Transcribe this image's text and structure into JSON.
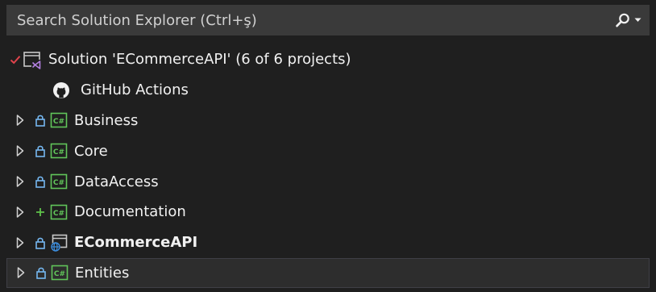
{
  "search": {
    "placeholder": "Search Solution Explorer (Ctrl+ş)",
    "icon": "search-icon"
  },
  "solution": {
    "label": "Solution 'ECommerceAPI' (6 of 6 projects)",
    "status_icon": "checkmark-icon",
    "icon": "solution-icon"
  },
  "github": {
    "label": "GitHub Actions",
    "icon": "github-icon"
  },
  "projects": [
    {
      "label": "Business",
      "state_icon": "lock-icon",
      "type_icon": "csharp-project-icon"
    },
    {
      "label": "Core",
      "state_icon": "lock-icon",
      "type_icon": "csharp-project-icon"
    },
    {
      "label": "DataAccess",
      "state_icon": "lock-icon",
      "type_icon": "csharp-project-icon"
    },
    {
      "label": "Documentation",
      "state_icon": "plus-icon",
      "type_icon": "csharp-project-icon"
    },
    {
      "label": "ECommerceAPI",
      "state_icon": "lock-icon",
      "type_icon": "web-project-icon",
      "bold": true
    },
    {
      "label": "Entities",
      "state_icon": "lock-icon",
      "type_icon": "csharp-project-icon",
      "selected": true
    }
  ],
  "colors": {
    "background": "#1f1f1f",
    "search_background": "#3a3a3a",
    "text": "#f1f1f1",
    "lock": "#75b7f0",
    "added": "#5fc34a",
    "checkmark": "#e0434c",
    "csharp_green": "#61c55a",
    "web_blue": "#3d8fe0"
  }
}
